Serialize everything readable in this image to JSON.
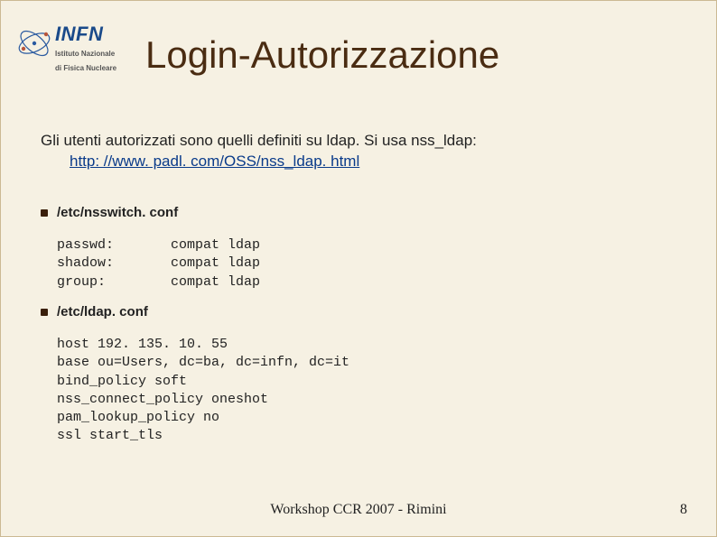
{
  "logo": {
    "acronym": "INFN",
    "sub1": "Istituto Nazionale",
    "sub2": "di Fisica Nucleare"
  },
  "title": "Login-Autorizzazione",
  "intro": {
    "line": "Gli utenti autorizzati sono quelli definiti su ldap. Si usa nss_ldap:",
    "link": "http: //www. padl. com/OSS/nss_ldap. html"
  },
  "sections": [
    {
      "heading": "/etc/nsswitch. conf",
      "code": "passwd:       compat ldap\nshadow:       compat ldap\ngroup:        compat ldap"
    },
    {
      "heading": "/etc/ldap. conf",
      "code": "host 192. 135. 10. 55\nbase ou=Users, dc=ba, dc=infn, dc=it\nbind_policy soft\nnss_connect_policy oneshot\npam_lookup_policy no\nssl start_tls"
    }
  ],
  "footer": "Workshop CCR 2007 - Rimini",
  "page": "8"
}
